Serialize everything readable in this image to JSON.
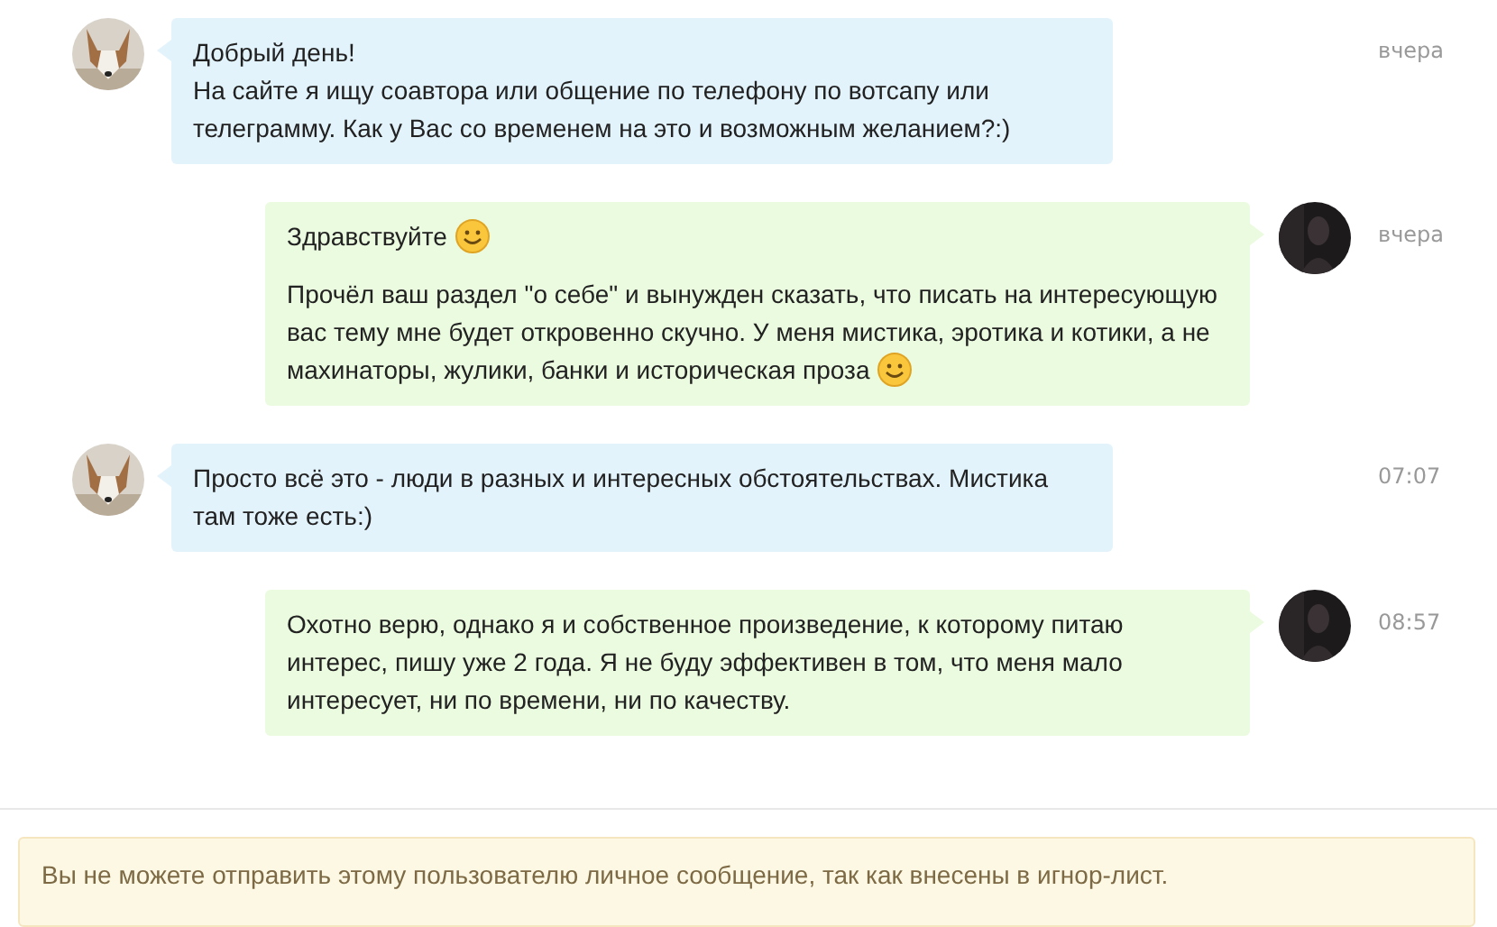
{
  "messages": [
    {
      "kind": "incoming",
      "avatar": {
        "kind": "picture"
      },
      "time": "вчера",
      "paragraphs": [
        {
          "lines": [
            "Добрый день!",
            "На сайте я ищу соавтора или общение по телефону по вотсапу или телеграмму. Как у Вас со временем на это и возможным желанием?:)"
          ],
          "emoji": false
        }
      ]
    },
    {
      "kind": "outgoing",
      "avatar": {
        "kind": "picture"
      },
      "time": "вчера",
      "paragraphs": [
        {
          "lines": [
            "Здравствуйте"
          ],
          "emoji": true
        },
        {
          "lines": [
            "Прочёл ваш раздел \"о себе\" и вынужден сказать, что писать на интересующую",
            "вас тему мне будет откровенно скучно. У меня мистика, эротика и котики, а не",
            "махинаторы, жулики, банки и историческая проза"
          ],
          "emoji": true
        }
      ]
    },
    {
      "kind": "incoming",
      "avatar": {
        "kind": "picture"
      },
      "time": "07:07",
      "paragraphs": [
        {
          "lines": [
            "Просто всё это - люди в разных и интересных обстоятельствах. Мистика там тоже есть:)"
          ],
          "emoji": false
        }
      ]
    },
    {
      "kind": "outgoing",
      "avatar": {
        "kind": "picture"
      },
      "time": "08:57",
      "paragraphs": [
        {
          "lines": [
            "Охотно верю, однако я и собственное произведение, к которому питаю интерес, пишу уже 2 года. Я не буду эффективен в том, что меня мало интересует, ни по времени, ни по качеству."
          ],
          "emoji": false
        }
      ]
    }
  ],
  "notice": "Вы не можете отправить этому пользователю личное сообщение, так как внесены в игнор-лист."
}
